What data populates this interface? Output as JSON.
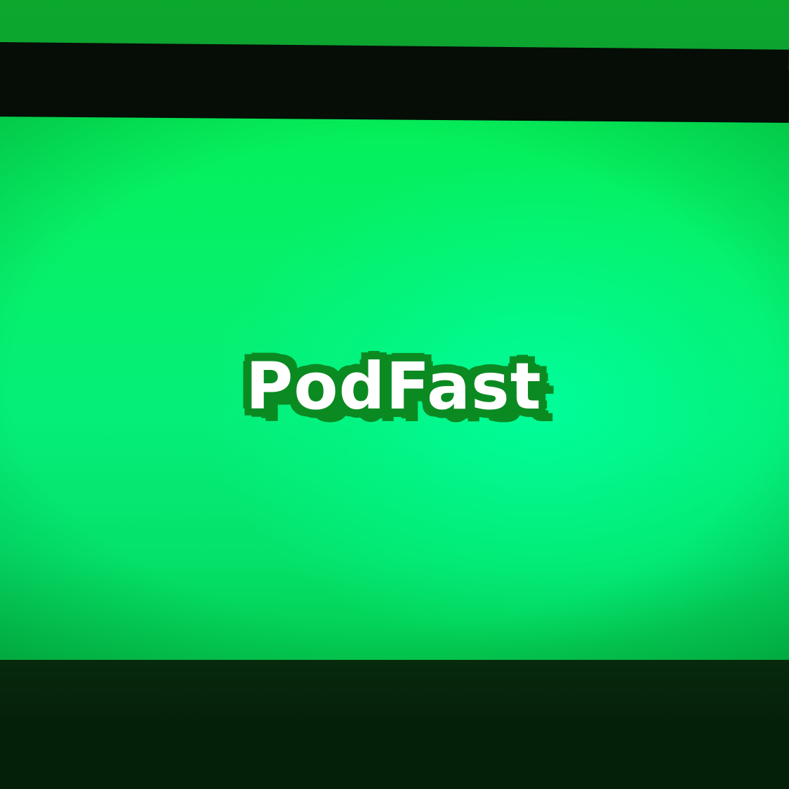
{
  "app": {
    "logo_text": "PodFast"
  },
  "colors": {
    "screen_green": "#05f06a",
    "logo_outline": "#0b8a22",
    "logo_text": "#ffffff",
    "bezel": "#050d06"
  }
}
